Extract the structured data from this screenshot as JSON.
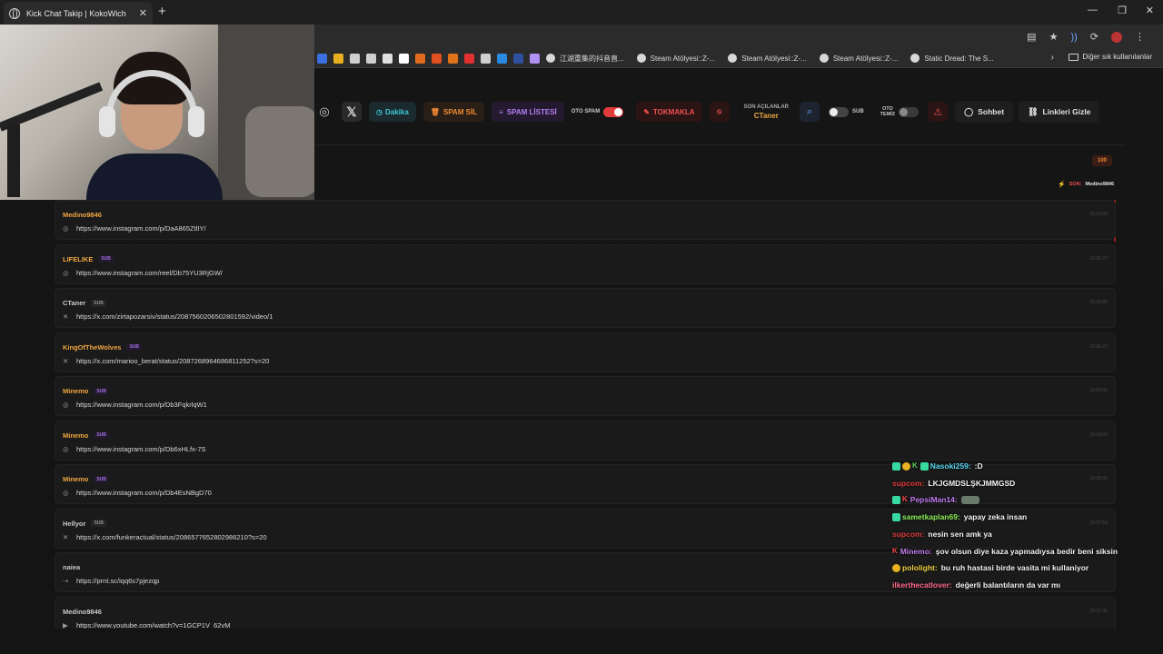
{
  "browser": {
    "tab_title": "Kick Chat Takip | KokoWich",
    "tab_close": "✕",
    "new_tab": "+",
    "window_controls": {
      "minimize": "—",
      "maximize": "❐",
      "close": "✕"
    },
    "bookmarks": [
      {
        "label": "江湖重集的抖音直..."
      },
      {
        "label": "Steam Atölyesi::Z-..."
      },
      {
        "label": "Steam Atölyesi::Z-..."
      },
      {
        "label": "Steam Atölyesi::Z-..."
      },
      {
        "label": "Static Dread: The S..."
      }
    ],
    "bookmark_icon_colors": [
      "#3b6fe0",
      "#e8b020",
      "#cfcfcf",
      "#cfcfcf",
      "#e0e0e0",
      "#ffffff",
      "#e06a20",
      "#e05020",
      "#e0731a",
      "#e03030",
      "#cfcfcf",
      "#2a8ae0",
      "#3050a0",
      "#b090f0"
    ],
    "more_chevron": "›",
    "other_bookmarks": "Diğer sık kullanılanlar"
  },
  "toolbar": {
    "instagram_icon": "◎",
    "x_icon": "𝕏",
    "dakika_label": "Dakika",
    "spam_sil_label": "SPAM SİL",
    "spam_listesi_label": "SPAM LİSTESİ",
    "oto_spam_label": "OTO SPAM",
    "oto_spam_on": true,
    "tokmakla_label": "TOKMAKLA",
    "son_acilanlar_label": "SON AÇILANLAR",
    "son_acilanlar_value": "CTaner",
    "sub_label": "SUB",
    "oto_temiz_label_1": "OTO",
    "oto_temiz_label_2": "TEMİZ",
    "sohbet_label": "Sohbet",
    "linkleri_gizle_label": "Linkleri Gizle"
  },
  "counter_badge": "100",
  "son_row": {
    "label": "SON:",
    "value": "Medino9846"
  },
  "links": [
    {
      "user": "Medino9846",
      "sub": false,
      "color": "gold",
      "platform": "instagram",
      "url": "https://www.instagram.com/p/DaA865ZtlIY/",
      "time": "20:02:04"
    },
    {
      "user": "LIFELIKE",
      "sub": true,
      "color": "gold",
      "platform": "instagram",
      "url": "https://www.instagram.com/reel/Db75YU3RjGW/",
      "time": "20:01:27"
    },
    {
      "user": "CTaner",
      "sub": true,
      "color": "gray",
      "platform": "x",
      "url": "https://x.com/zirtapozarsiv/status/2087560206502801592/video/1",
      "time": "20:00:56"
    },
    {
      "user": "KingOfTheWolves",
      "sub": true,
      "color": "gold",
      "platform": "x",
      "url": "https://x.com/marioo_berat/status/2087268964686811252?s=20",
      "time": "20:00:27"
    },
    {
      "user": "Minemo",
      "sub": true,
      "color": "gold",
      "platform": "instagram",
      "url": "https://www.instagram.com/p/Db3FqkrlqW1",
      "time": "19:59:31"
    },
    {
      "user": "Minemo",
      "sub": true,
      "color": "gold",
      "platform": "instagram",
      "url": "https://www.instagram.com/p/Db6xHLfx-7S",
      "time": "19:59:09"
    },
    {
      "user": "Minemo",
      "sub": true,
      "color": "gold",
      "platform": "instagram",
      "url": "https://www.instagram.com/p/Db4EsNBgD70",
      "time": "19:58:32"
    },
    {
      "user": "Hellyor",
      "sub": true,
      "color": "gray",
      "platform": "x",
      "url": "https://x.com/funkeractual/status/2086577652802986210?s=20",
      "time": "19:57:54"
    },
    {
      "user": "naiea",
      "sub": false,
      "color": "gray",
      "platform": "link",
      "url": "https://prnt.sc/iqq6s7pjezqp",
      "time": ""
    },
    {
      "user": "Medino9846",
      "sub": false,
      "color": "gray",
      "platform": "youtube",
      "url": "https://www.youtube.com/watch?v=1GCP1V_62vM",
      "time": "19:57:35"
    }
  ],
  "sub_badge": "SUB",
  "platform_icons": {
    "instagram": "◎",
    "x": "✕",
    "link": "⇢",
    "youtube": "▶"
  },
  "chat": [
    {
      "badges": [
        "g",
        "y",
        "k",
        "g"
      ],
      "user": "Nasoki259:",
      "color": "cyan",
      "msg": ":D"
    },
    {
      "badges": [],
      "user": "supcom:",
      "color": "red",
      "msg": "LKJGMDSLŞKJMMGSD"
    },
    {
      "badges": [
        "g",
        "kr"
      ],
      "user": "PepsiMan14:",
      "color": "purple",
      "msg": "",
      "emote": true
    },
    {
      "badges": [
        "g"
      ],
      "user": "sametkaplan69:",
      "color": "lime",
      "msg": "yapay zeka insan"
    },
    {
      "badges": [],
      "user": "supcom:",
      "color": "red",
      "msg": "nesin sen amk ya"
    },
    {
      "badges": [
        "kr"
      ],
      "user": "Minemo:",
      "color": "purple",
      "msg": "şov olsun diye kaza yapmadıysa bedir beni siksin"
    },
    {
      "badges": [
        "y"
      ],
      "user": "pololight:",
      "color": "yellow",
      "msg": "bu ruh hastasi birde vasita mi kullaniyor"
    },
    {
      "badges": [],
      "user": "ilkerthecatlover:",
      "color": "pink",
      "msg": "değerli balantıların da var mı"
    }
  ]
}
